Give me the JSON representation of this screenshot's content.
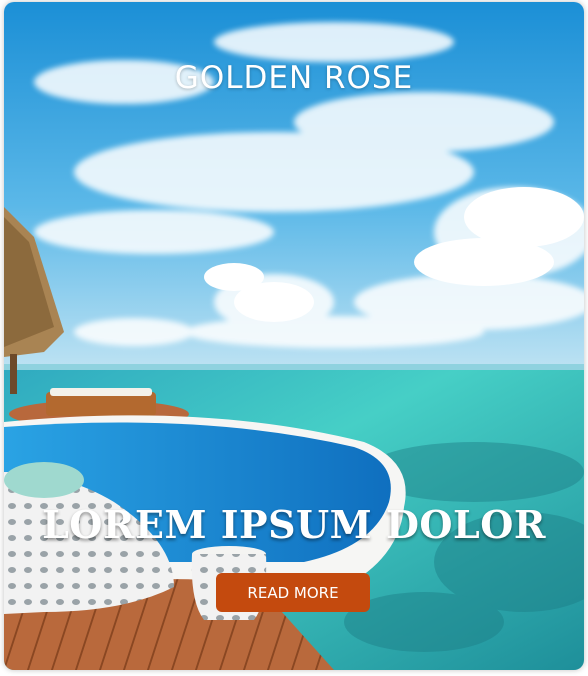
{
  "hero": {
    "brand": "GOLDEN ROSE",
    "headline": "LOREM IPSUM DOLOR",
    "button_label": "READ MORE",
    "image_subject": "maldives-infinity-pool-ocean-photo"
  },
  "colors": {
    "button": "#c44a0e",
    "sky": "#3aa6df",
    "lagoon": "#3fc7c0",
    "pool": "#1e90d8",
    "deck": "#b8683c"
  }
}
